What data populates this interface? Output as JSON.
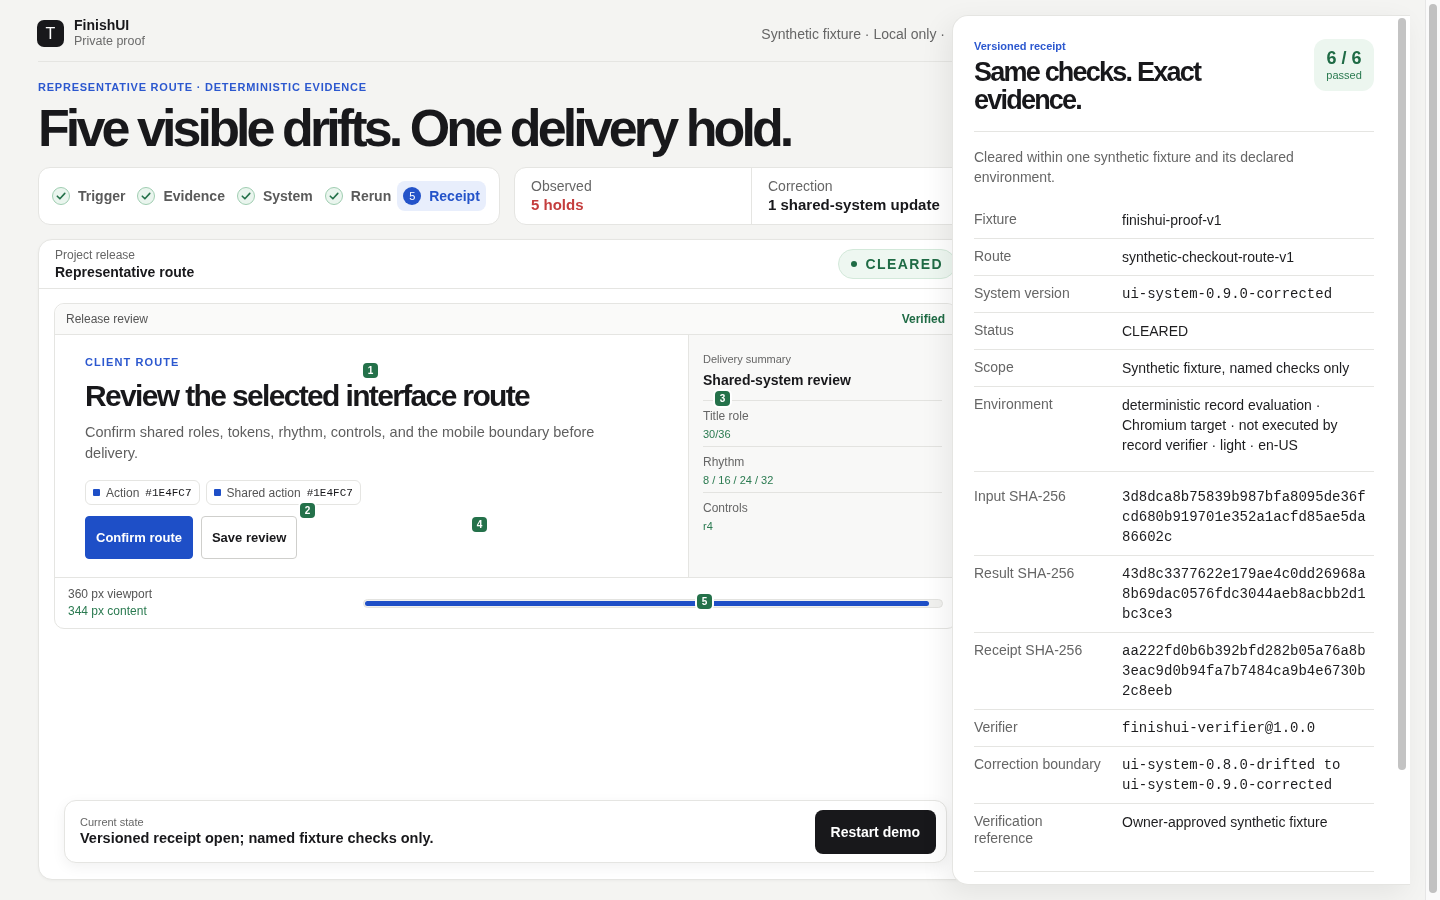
{
  "header": {
    "logo_letter": "T",
    "app_name": "FinishUI",
    "subtitle": "Private proof",
    "meta": "Synthetic fixture · Local only ·"
  },
  "hero": {
    "eyebrow": "REPRESENTATIVE ROUTE · DETERMINISTIC EVIDENCE",
    "title": "Five visible drifts. One delivery hold."
  },
  "steps": [
    {
      "label": "Trigger",
      "done": true,
      "selected": false
    },
    {
      "label": "Evidence",
      "done": true,
      "selected": false
    },
    {
      "label": "System",
      "done": true,
      "selected": false
    },
    {
      "label": "Rerun",
      "done": true,
      "selected": false
    },
    {
      "label": "Receipt",
      "number": "5",
      "done": false,
      "selected": true
    }
  ],
  "outcomes": [
    {
      "label": "Observed",
      "value": "5 holds",
      "kind": "alert"
    },
    {
      "label": "Correction",
      "value": "1 shared-system update",
      "kind": "plain"
    }
  ],
  "project": {
    "label": "Project release",
    "name": "Representative route",
    "status": "CLEARED"
  },
  "review": {
    "title": "Release review",
    "status": "Verified",
    "route": {
      "eyebrow": "CLIENT ROUTE",
      "heading": "Review the selected interface route",
      "body": "Confirm shared roles, tokens, rhythm, controls, and the mobile boundary before delivery.",
      "tokens": [
        {
          "label": "Action",
          "value": "#1E4FC7",
          "color": "#1e4fc7"
        },
        {
          "label": "Shared action",
          "value": "#1E4FC7",
          "color": "#1e4fc7"
        }
      ],
      "buttons": [
        {
          "label": "Confirm route",
          "kind": "primary"
        },
        {
          "label": "Save review",
          "kind": "secondary"
        }
      ]
    },
    "summary": {
      "label": "Delivery summary",
      "title": "Shared-system review",
      "metrics": [
        {
          "label": "Title role",
          "value": "30/36"
        },
        {
          "label": "Rhythm",
          "value": "8 / 16 / 24 / 32"
        },
        {
          "label": "Controls",
          "value": "r4"
        }
      ]
    },
    "viewport": {
      "label": "360 px viewport",
      "content": "344 px content",
      "level": 0.98
    },
    "markers": [
      "1",
      "2",
      "3",
      "4",
      "5"
    ]
  },
  "current_state": {
    "label": "Current state",
    "text": "Versioned receipt open; named fixture checks only.",
    "button": "Restart demo"
  },
  "receipt": {
    "eyebrow": "Versioned receipt",
    "title": "Same checks. Exact evidence.",
    "score": "6 / 6",
    "score_label": "passed",
    "description": "Cleared within one synthetic fixture and its declared environment.",
    "sections": [
      {
        "rows": [
          {
            "label": "Fixture",
            "value": "finishui-proof-v1",
            "kind": "text"
          },
          {
            "label": "Route",
            "value": "synthetic-checkout-route-v1",
            "kind": "text"
          },
          {
            "label": "System version",
            "value": "ui-system-0.9.0-corrected",
            "kind": "code"
          },
          {
            "label": "Status",
            "value": "CLEARED",
            "kind": "text"
          },
          {
            "label": "Scope",
            "value": "Synthetic fixture, named checks only",
            "kind": "text"
          },
          {
            "label": "Environment",
            "value": "deterministic record evaluation · Chromium target · not executed by record verifier · light · en-US",
            "kind": "text"
          }
        ]
      },
      {
        "rows": [
          {
            "label": "Input SHA-256",
            "value": "3d8dca8b75839b987bfa8095de36fcd680b919701e352a1acfd85ae5da86602c",
            "kind": "code"
          },
          {
            "label": "Result SHA-256",
            "value": "43d8c3377622e179ae4c0dd26968a8b69dac0576fdc3044aeb8acbb2d1bc3ce3",
            "kind": "code"
          },
          {
            "label": "Receipt SHA-256",
            "value": "aa222fd0b6b392bfd282b05a76a8b3eac9d0b94fa7b7484ca9b4e6730b2c8eeb",
            "kind": "code"
          },
          {
            "label": "Verifier",
            "value": "finishui-verifier@1.0.0",
            "kind": "code"
          },
          {
            "label": "Correction boundary",
            "value": "ui-system-0.8.0-drifted to ui-system-0.9.0-corrected",
            "kind": "code"
          },
          {
            "label": "Verification reference",
            "value": "Owner-approved synthetic fixture",
            "kind": "text"
          }
        ]
      }
    ]
  }
}
